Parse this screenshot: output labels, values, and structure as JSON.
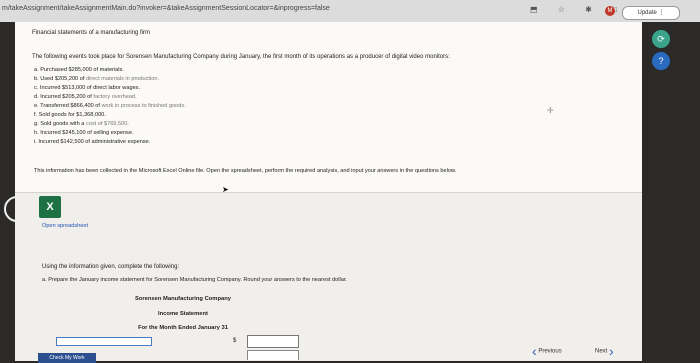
{
  "browser": {
    "url": "m/takeAssignment/takeAssignmentMain.do?invoker=&takeAssignmentSessionLocator=&inprogress=false",
    "icons": "⬒ ☆ ✱ □",
    "badge": "M",
    "update_label": "Update ⋮"
  },
  "page": {
    "heading": "Financial statements of a manufacturing firm",
    "intro": "The following events took place for Sorensen Manufacturing Company during January, the first month of its operations as a producer of digital video monitors:",
    "events": [
      {
        "lead": "a. Purchased $285,000 of materials.",
        "tail": ""
      },
      {
        "lead": "b. Used $205,200 of",
        "tail": " direct materials in production."
      },
      {
        "lead": "c. Incurred $513,000 of direct labor wages.",
        "tail": ""
      },
      {
        "lead": "d. Incurred $205,200 of",
        "tail": " factory overhead."
      },
      {
        "lead": "e. Transferred $866,400 of",
        "tail": " work in process to finished goods."
      },
      {
        "lead": "f. Sold goods for $1,368,000.",
        "tail": ""
      },
      {
        "lead": "g. Sold goods with a",
        "tail": " cost of $769,500."
      },
      {
        "lead": "h. Incurred $245,100 of selling expense.",
        "tail": ""
      },
      {
        "lead": "i. Incurred $142,500 of administrative expense.",
        "tail": ""
      }
    ],
    "info_note": "This information has been collected in the Microsoft Excel Online file. Open the spreadsheet, perform the required analysis, and input your answers in the questions below.",
    "excel_icon_text": "X",
    "open_spreadsheet": "Open spreadsheet",
    "question_intro": "Using the information given, complete the following:",
    "question_a": "a. Prepare the January income statement for Sorensen Manufacturing Company. Round your answers to the nearest dollar.",
    "statement": {
      "company": "Sorensen Manufacturing Company",
      "title": "Income Statement",
      "period": "For the Month Ended January 31"
    },
    "dollar_sign": "$",
    "check_label": "Check My Work",
    "previous_label": "Previous",
    "next_label": "Next"
  },
  "colors": {
    "accent": "#2a5fb5",
    "excel": "#1e7145",
    "badge": "#c0392b"
  }
}
